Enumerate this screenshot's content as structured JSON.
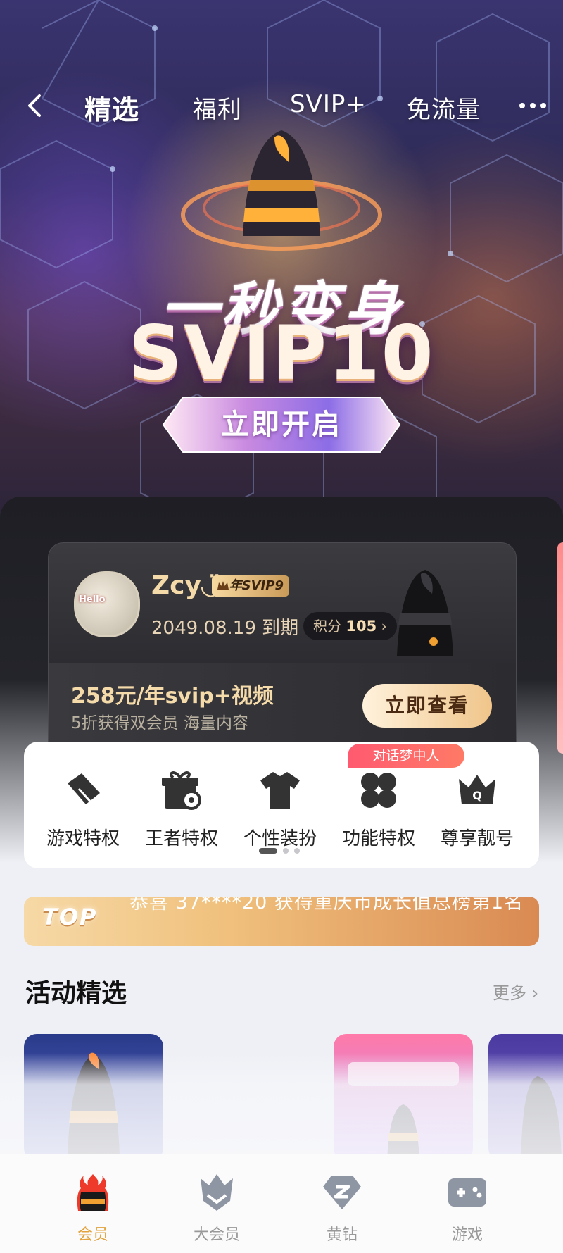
{
  "nav": {
    "tabs": [
      "精选",
      "福利",
      "SVIP+",
      "免流量"
    ],
    "active_tab": "精选"
  },
  "hero": {
    "line1": "一秒变身",
    "line2": "SVIP10",
    "button": "立即开启"
  },
  "member": {
    "username": "Zcy◡̈",
    "vip_badge": "年SVIP9",
    "avatar_text": "Hello",
    "expire": "2049.08.19 到期",
    "points_label": "积分",
    "points_value": "105",
    "promo_title": "258元/年svip+视频",
    "promo_sub": "5折获得双会员 海量内容",
    "promo_button": "立即查看"
  },
  "features": {
    "tag": "对话梦中人",
    "items": [
      {
        "label": "游戏特权",
        "icon": "game-privilege-icon"
      },
      {
        "label": "王者特权",
        "icon": "gift-privilege-icon"
      },
      {
        "label": "个性装扮",
        "icon": "tshirt-icon"
      },
      {
        "label": "功能特权",
        "icon": "clover-icon"
      },
      {
        "label": "尊享靓号",
        "icon": "crown-icon"
      }
    ]
  },
  "toplist": {
    "badge": "TOP",
    "text": "恭喜 37****20 获得重庆市成长值总榜第1名"
  },
  "activities": {
    "title": "活动精选",
    "more": "更多"
  },
  "tabbar": {
    "items": [
      {
        "label": "会员",
        "active": true,
        "icon": "member-icon"
      },
      {
        "label": "大会员",
        "active": false,
        "icon": "big-member-icon"
      },
      {
        "label": "黄钻",
        "active": false,
        "icon": "yellow-diamond-icon"
      },
      {
        "label": "游戏",
        "active": false,
        "icon": "gamepad-icon"
      }
    ]
  },
  "colors": {
    "accent_gold": "#f4d9a9",
    "tag_red": "#ff5a70",
    "tab_active": "#e2a33c"
  }
}
